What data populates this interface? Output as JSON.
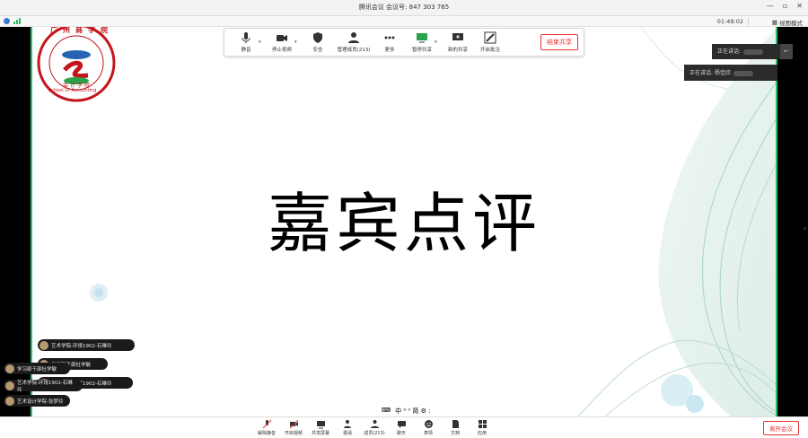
{
  "window": {
    "title": "腾讯会议 会议号: 847 303 765"
  },
  "status": {
    "time": "01:49:02",
    "view_label": "视图模式"
  },
  "toolbar": {
    "items": [
      {
        "label": "静音"
      },
      {
        "label": "停止视频"
      },
      {
        "label": "安全"
      },
      {
        "label": "管理成员(213)"
      },
      {
        "label": "更多"
      },
      {
        "label": "暂停共享"
      },
      {
        "label": "新的共享"
      },
      {
        "label": "开启批注"
      }
    ],
    "end_label": "结束共享"
  },
  "slide": {
    "heading": "嘉宾点评",
    "logo_top": "广州商学院",
    "logo_bottom": "会计学院",
    "logo_en": "School Of Accounting"
  },
  "speaker_panel": {
    "speaking_label": "正在讲话:",
    "now_label": "正在讲话: 杨佳欣"
  },
  "chat_messages": [
    {
      "text": "艺术学院-环境1902-石琳玲"
    },
    {
      "text": "学习部干部杜学敏"
    },
    {
      "text": "学习部干部杜学敏"
    },
    {
      "text": "艺术学院-环境1902-石琳玲"
    },
    {
      "text": "艺术学院-环境1902-石琳玲"
    },
    {
      "text": "艺术设计学院-张梦玲"
    }
  ],
  "mini_toolbar": "中 ⁹ ⁰ 简 ⚙ :",
  "bottombar": {
    "items": [
      {
        "label": "解除静音"
      },
      {
        "label": "开启视频"
      },
      {
        "label": "共享屏幕"
      },
      {
        "label": "邀请"
      },
      {
        "label": "成员(213)"
      },
      {
        "label": "聊天"
      },
      {
        "label": "表情"
      },
      {
        "label": "文档"
      },
      {
        "label": "应用"
      }
    ],
    "leave_label": "离开会议"
  }
}
